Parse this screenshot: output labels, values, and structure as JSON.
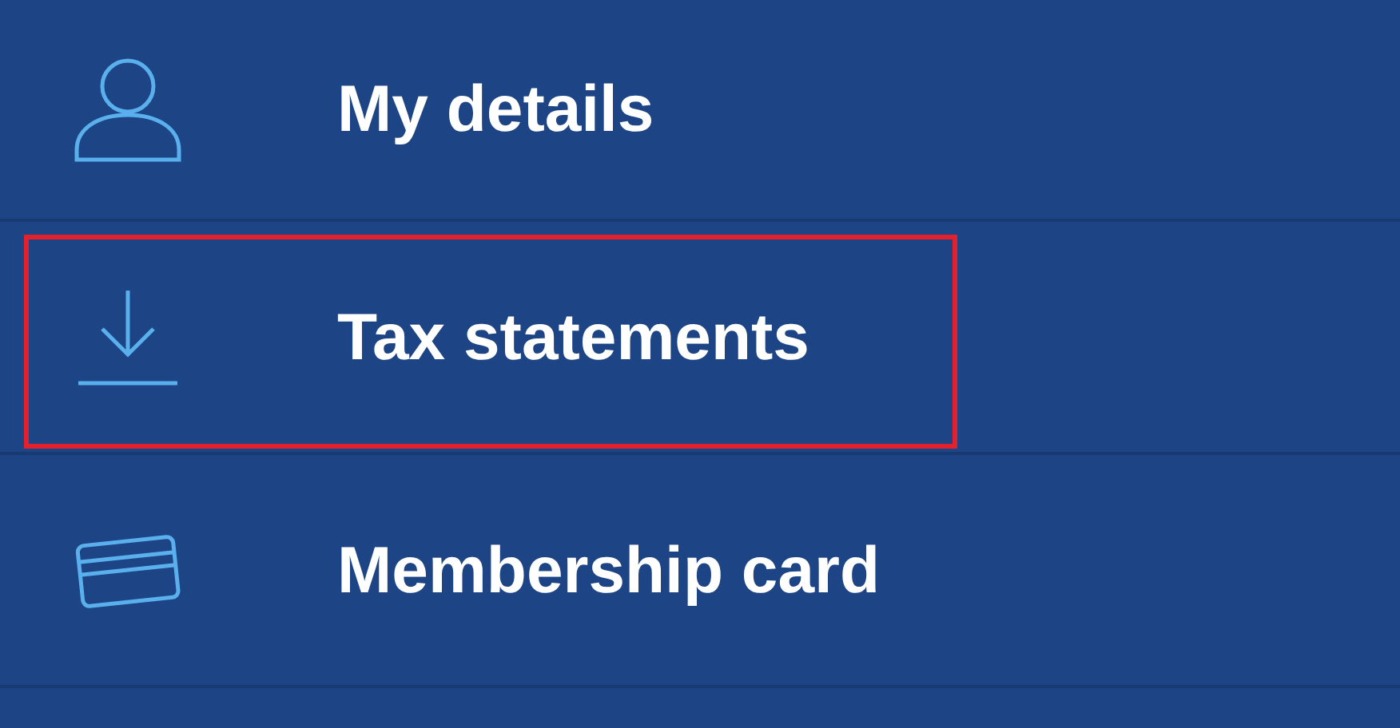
{
  "menu": {
    "items": [
      {
        "kind": "person",
        "label": "My details",
        "highlighted": false
      },
      {
        "kind": "download",
        "label": "Tax statements",
        "highlighted": true
      },
      {
        "kind": "card",
        "label": "Membership card",
        "highlighted": false
      }
    ]
  }
}
